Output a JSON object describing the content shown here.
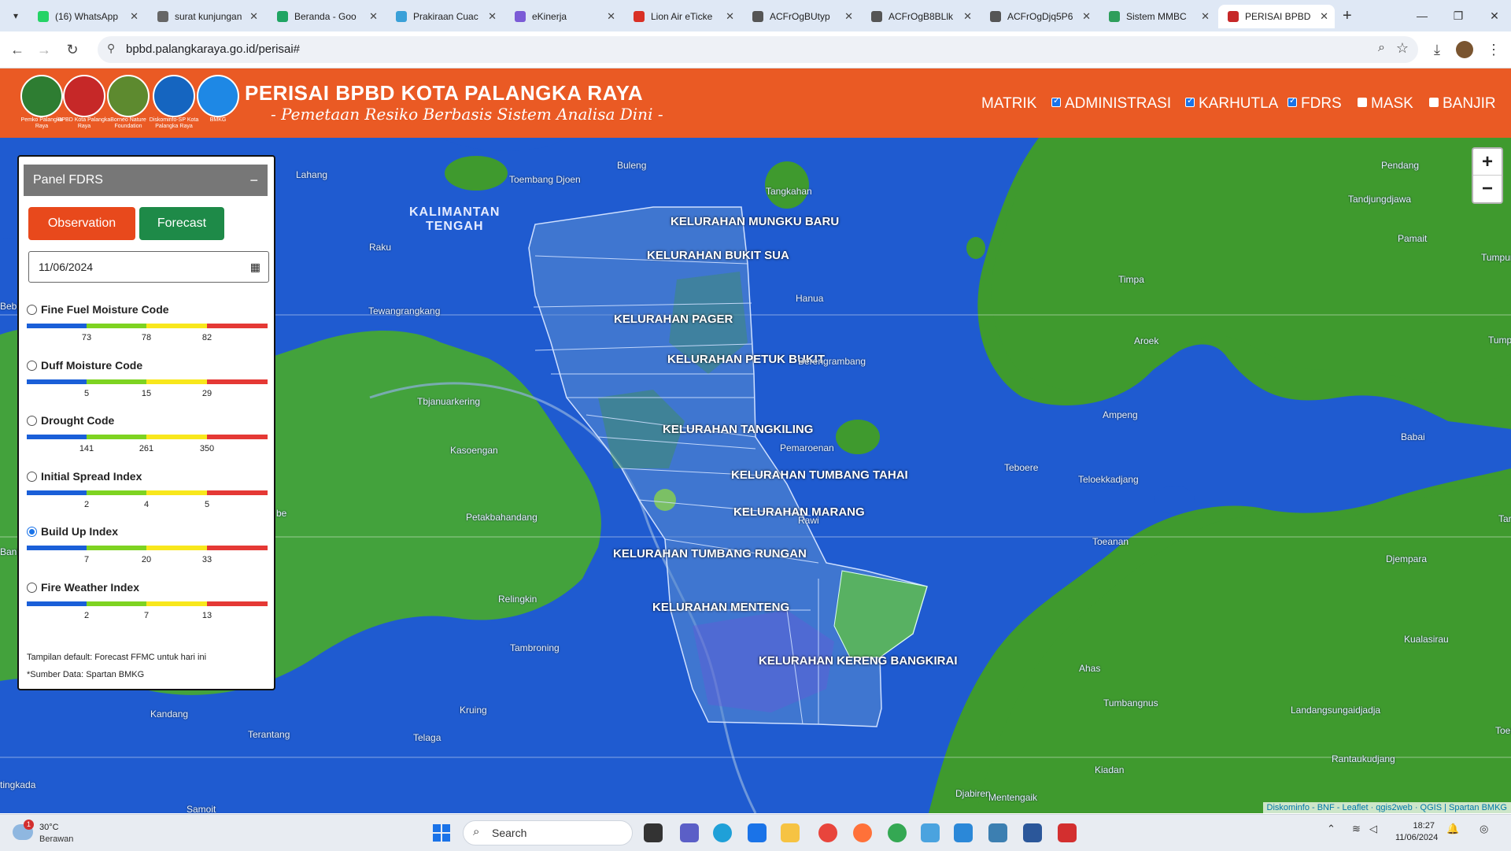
{
  "browser": {
    "tabs": [
      {
        "label": "(16) WhatsApp",
        "favicon_color": "#25d366"
      },
      {
        "label": "surat kunjungan",
        "favicon_color": "#666666"
      },
      {
        "label": "Beranda - Goo",
        "favicon_color": "#1fa463"
      },
      {
        "label": "Prakiraan Cuac",
        "favicon_color": "#3aa0d8"
      },
      {
        "label": "eKinerja",
        "favicon_color": "#7b5bd6"
      },
      {
        "label": "Lion Air eTicke",
        "favicon_color": "#d93025"
      },
      {
        "label": "ACFrOgBUtyp",
        "favicon_color": "#555555"
      },
      {
        "label": "ACFrOgB8BLlk",
        "favicon_color": "#555555"
      },
      {
        "label": "ACFrOgDjq5P6",
        "favicon_color": "#555555"
      },
      {
        "label": "Sistem MMBC",
        "favicon_color": "#2e9e5b"
      },
      {
        "label": "PERISAI BPBD",
        "favicon_color": "#c62828"
      }
    ],
    "url": "bpbd.palangkaraya.go.id/perisai#"
  },
  "header": {
    "title": "PERISAI BPBD KOTA PALANGKA RAYA",
    "subtitle": "- Pemetaan Resiko Berbasis Sistem Analisa Dini -",
    "logos": [
      {
        "caption": "Pemko Palangka Raya",
        "color": "#2e7d32"
      },
      {
        "caption": "BPBD Kota Palangka Raya",
        "color": "#c62828"
      },
      {
        "caption": "Borneo Nature Foundation",
        "color": "#5d8a2f"
      },
      {
        "caption": "Diskominfo-SP Kota Palangka Raya",
        "color": "#1565c0"
      },
      {
        "caption": "BMKG",
        "color": "#1e88e5"
      }
    ],
    "menu": [
      {
        "label": "MATRIK",
        "checkbox": "none"
      },
      {
        "label": "ADMINISTRASI",
        "checkbox": "checked"
      },
      {
        "label": "KARHUTLA",
        "checkbox": "checked"
      },
      {
        "label": "FDRS",
        "checkbox": "checked"
      },
      {
        "label": "MASK",
        "checkbox": "unchecked"
      },
      {
        "label": "BANJIR",
        "checkbox": "unchecked"
      }
    ]
  },
  "panel": {
    "title": "Panel FDRS",
    "minimize": "−",
    "observation_label": "Observation",
    "forecast_label": "Forecast",
    "date_value": "11/06/2024",
    "indices": [
      {
        "name": "Fine Fuel Moisture Code",
        "ticks": [
          "73",
          "78",
          "82"
        ],
        "selected": false
      },
      {
        "name": "Duff Moisture Code",
        "ticks": [
          "5",
          "15",
          "29"
        ],
        "selected": false
      },
      {
        "name": "Drought Code",
        "ticks": [
          "141",
          "261",
          "350"
        ],
        "selected": false
      },
      {
        "name": "Initial Spread Index",
        "ticks": [
          "2",
          "4",
          "5"
        ],
        "selected": false
      },
      {
        "name": "Build Up Index",
        "ticks": [
          "7",
          "20",
          "33"
        ],
        "selected": true
      },
      {
        "name": "Fire Weather Index",
        "ticks": [
          "2",
          "7",
          "13"
        ],
        "selected": false
      }
    ],
    "scale_colors": [
      "#1a5fd8",
      "#7ed321",
      "#f8e71c",
      "#e53935"
    ],
    "note_default": "Tampilan default: Forecast FFMC untuk hari ini",
    "note_source": "*Sumber Data: Spartan BMKG"
  },
  "map": {
    "region_label": "KALIMANTAN TENGAH",
    "kelurahan": [
      "KELURAHAN MUNGKU BARU",
      "KELURAHAN BUKIT SUA",
      "KELURAHAN PAGER",
      "KELURAHAN PETUK BUKIT",
      "KELURAHAN TANGKILING",
      "KELURAHAN TUMBANG TAHAI",
      "KELURAHAN MARANG",
      "KELURAHAN TUMBANG RUNGAN",
      "KELURAHAN MENTENG",
      "KELURAHAN KERENG BANGKIRAI"
    ],
    "places": [
      "Lahang",
      "Buleng",
      "Toembang Djoen",
      "Tangkahan",
      "Raku",
      "Tewangrangkang",
      "Hanua",
      "Berengrambang",
      "Tbjanuarkering",
      "Kasoengan",
      "Pemaroenan",
      "Petakbahandang",
      "Rawi",
      "Relingkin",
      "Tambroning",
      "Kandang",
      "Kruing",
      "Terantang",
      "Telaga",
      "Samoit",
      "tingkada",
      "Timpa",
      "Aroek",
      "Ampeng",
      "Teboere",
      "Teloekkadjang",
      "Toeanan",
      "Ahas",
      "Tumbangnus",
      "Kiadan",
      "Mentengaik",
      "Djabiren",
      "Pendang",
      "Tandjungdjawa",
      "Pamait",
      "Tumpung",
      "Tumpu",
      "Babai",
      "Tar",
      "Djempara",
      "Kualasirau",
      "Landangsungaidjadja",
      "Toempak",
      "Rantaukudjang",
      "Beban",
      "Banb",
      "be"
    ],
    "zoom_in": "+",
    "zoom_out": "−",
    "attribution": "Diskominfo - BNF - Leaflet · qgis2web · QGIS | Spartan BMKG"
  },
  "taskbar": {
    "weather_temp": "30°C",
    "weather_desc": "Berawan",
    "weather_badge": "1",
    "search_label": "Search",
    "time": "18:27",
    "date": "11/06/2024"
  }
}
